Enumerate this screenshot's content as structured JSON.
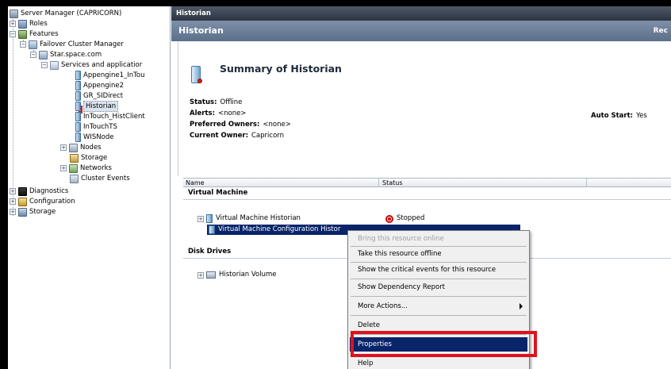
{
  "tree": {
    "root": "Server Manager (CAPRICORN)",
    "roles": "Roles",
    "features": "Features",
    "fcm": "Failover Cluster Manager",
    "cluster": "Star.space.com",
    "services": "Services and applicatior",
    "apps": [
      "Appengine1_InTou",
      "Appengine2",
      "GR_SIDirect",
      "Historian",
      "InTouch_HistClient",
      "InTouchTS",
      "WISNode"
    ],
    "nodes": "Nodes",
    "storage": "Storage",
    "networks": "Networks",
    "cluster_events": "Cluster Events",
    "diagnostics": "Diagnostics",
    "configuration": "Configuration",
    "storage_root": "Storage"
  },
  "titlebar": {
    "title": "Historian"
  },
  "header": {
    "title": "Historian",
    "right_text": "Rec"
  },
  "summary": {
    "title": "Summary of Historian",
    "status_label": "Status:",
    "status_value": "Offline",
    "alerts_label": "Alerts:",
    "alerts_value": "<none>",
    "preferred_label": "Preferred Owners:",
    "preferred_value": "<none>",
    "owner_label": "Current Owner:",
    "owner_value": "Capricorn",
    "autostart_label": "Auto Start:",
    "autostart_value": "Yes"
  },
  "grid": {
    "columns": [
      "Name",
      "Status"
    ],
    "group_vm": "Virtual Machine",
    "vm_row": {
      "name": "Virtual Machine Historian",
      "status": "Stopped"
    },
    "vm_config_row": {
      "name": "Virtual Machine Configuration Histor"
    },
    "group_disk": "Disk Drives",
    "disk_row": {
      "name": "Historian Volume"
    }
  },
  "context_menu": {
    "items": [
      "Bring this resource online",
      "Take this resource offline",
      "Show the critical events for this resource",
      "Show Dependency Report",
      "More Actions...",
      "Delete",
      "Properties",
      "Help"
    ]
  },
  "colors": {
    "selection": "#0a246a",
    "highlight_box": "#e0111f",
    "header": "#6b7e98"
  }
}
